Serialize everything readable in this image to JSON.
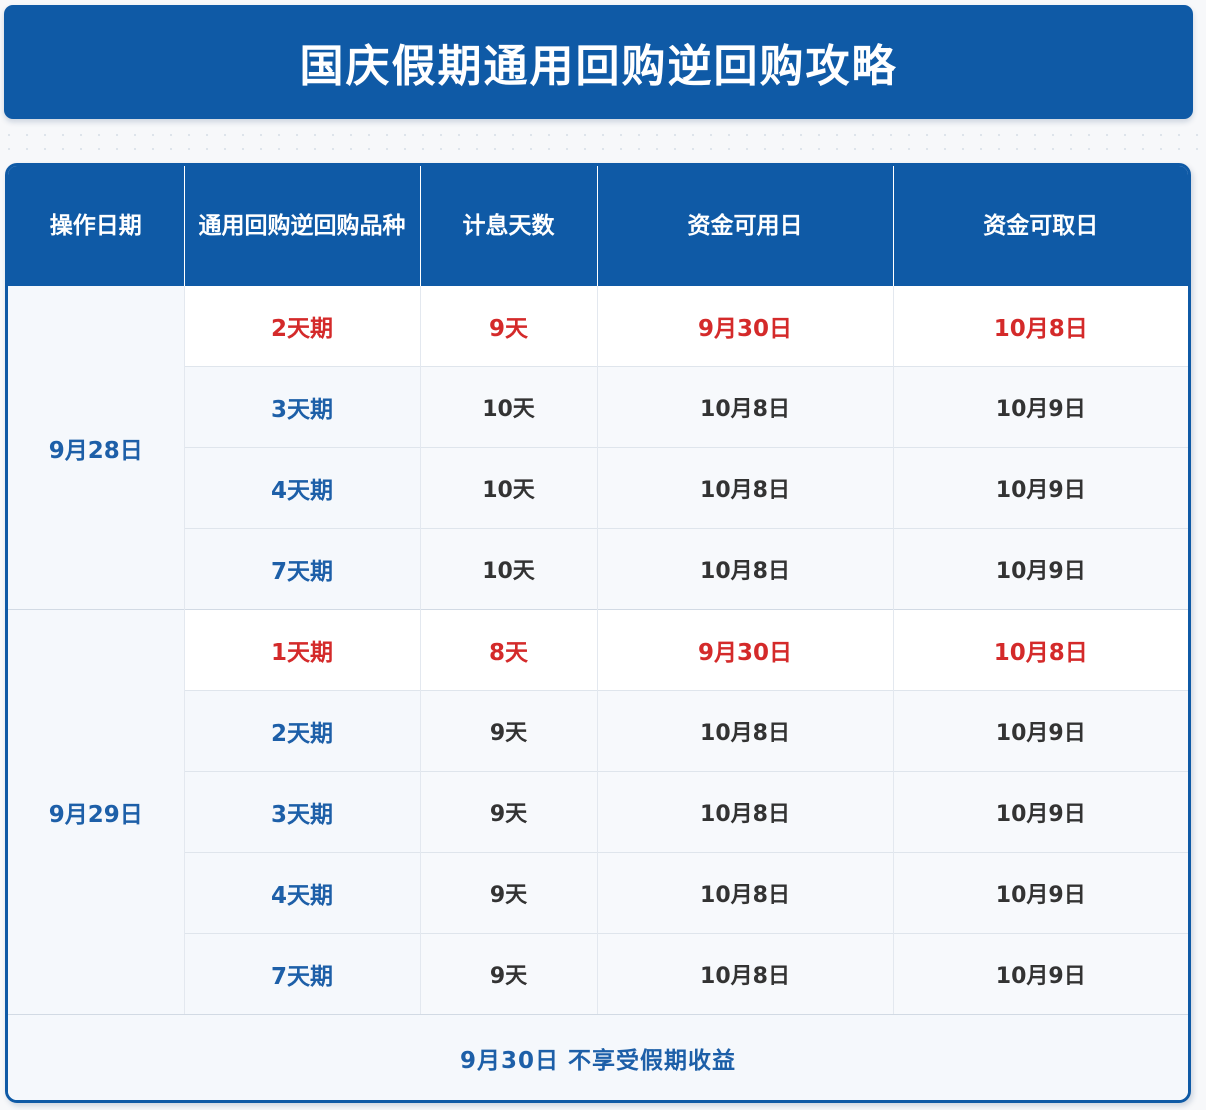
{
  "title": "国庆假期通用回购逆回购攻略",
  "headers": [
    "操作日期",
    "通用回购逆回购品种",
    "计息天数",
    "资金可用日",
    "资金可取日"
  ],
  "groups": [
    {
      "date": "9月28日",
      "rows": [
        {
          "variety": "2天期",
          "days": "9天",
          "available": "9月30日",
          "withdrawable": "10月8日",
          "highlight": true
        },
        {
          "variety": "3天期",
          "days": "10天",
          "available": "10月8日",
          "withdrawable": "10月9日",
          "highlight": false
        },
        {
          "variety": "4天期",
          "days": "10天",
          "available": "10月8日",
          "withdrawable": "10月9日",
          "highlight": false
        },
        {
          "variety": "7天期",
          "days": "10天",
          "available": "10月8日",
          "withdrawable": "10月9日",
          "highlight": false
        }
      ]
    },
    {
      "date": "9月29日",
      "rows": [
        {
          "variety": "1天期",
          "days": "8天",
          "available": "9月30日",
          "withdrawable": "10月8日",
          "highlight": true
        },
        {
          "variety": "2天期",
          "days": "9天",
          "available": "10月8日",
          "withdrawable": "10月9日",
          "highlight": false
        },
        {
          "variety": "3天期",
          "days": "9天",
          "available": "10月8日",
          "withdrawable": "10月9日",
          "highlight": false
        },
        {
          "variety": "4天期",
          "days": "9天",
          "available": "10月8日",
          "withdrawable": "10月9日",
          "highlight": false
        },
        {
          "variety": "7天期",
          "days": "9天",
          "available": "10月8日",
          "withdrawable": "10月9日",
          "highlight": false
        }
      ]
    }
  ],
  "footer": "9月30日 不享受假期收益",
  "colors": {
    "brand_blue": "#0f5aa6",
    "text_blue": "#1d5fa8",
    "highlight_red": "#d42a2a"
  }
}
